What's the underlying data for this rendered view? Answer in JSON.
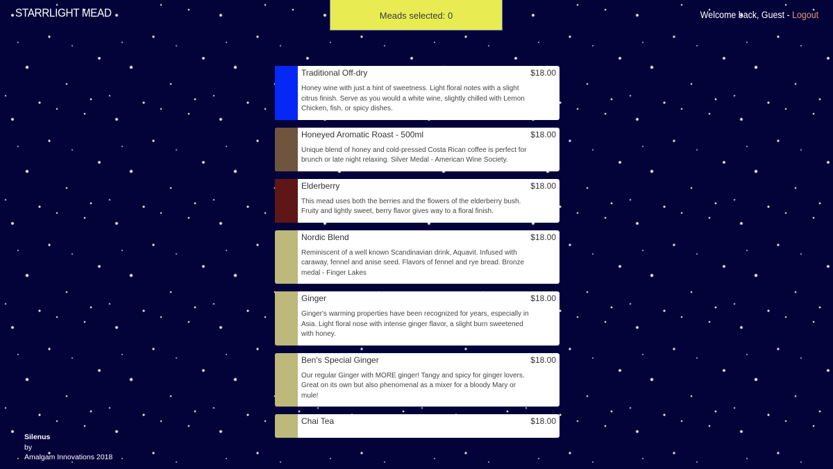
{
  "header": {
    "brand": "STARRLIGHT MEAD",
    "counter_text": "Meads selected: 0",
    "welcome_text": "Welcome back, Guest - ",
    "logout_label": "Logout"
  },
  "meads": [
    {
      "name": "Traditional Off-dry",
      "price": "$18.00",
      "color": "#0628f5",
      "description": "Honey wine with just a hint of sweetness. Light floral notes with a slight citrus finish. Serve as you would a white wine, slightly chilled with Lemon Chicken, fish, or spicy dishes."
    },
    {
      "name": "Honeyed Aromatic Roast - 500ml",
      "price": "$18.00",
      "color": "#6f543e",
      "description": "Unique blend of honey and cold-pressed Costa Rican coffee is perfect for brunch or late night relaxing. Silver Medal - American Wine Society."
    },
    {
      "name": "Elderberry",
      "price": "$18.00",
      "color": "#5f1616",
      "description": "This mead uses both the berries and the flowers of the elderberry bush. Fruity and lightly sweet, berry flavor gives way to a floral finish."
    },
    {
      "name": "Nordic Blend",
      "price": "$18.00",
      "color": "#bcb97a",
      "description": "Reminiscent of a well known Scandinavian drink, Aquavit. Infused with caraway, fennel and anise seed. Flavors of fennel and rye bread. Bronze medal - Finger Lakes"
    },
    {
      "name": "Ginger",
      "price": "$18.00",
      "color": "#bcb97a",
      "description": "Ginger's warming properties have been recognized for years, especially in Asia. Light floral nose with intense ginger flavor, a slight burn sweetened with honey."
    },
    {
      "name": "Ben's Special Ginger",
      "price": "$18.00",
      "color": "#bcb97a",
      "description": "Our regular Ginger with MORE ginger! Tangy and spicy for ginger lovers. Great on its own but also phenomenal as a mixer for a bloody Mary or mule!"
    },
    {
      "name": "Chai Tea",
      "price": "$18.00",
      "color": "#bcb97a",
      "description": ""
    }
  ],
  "footer": {
    "product": "Silenus",
    "by": "by",
    "company": "Amalgam Innovations 2018"
  }
}
